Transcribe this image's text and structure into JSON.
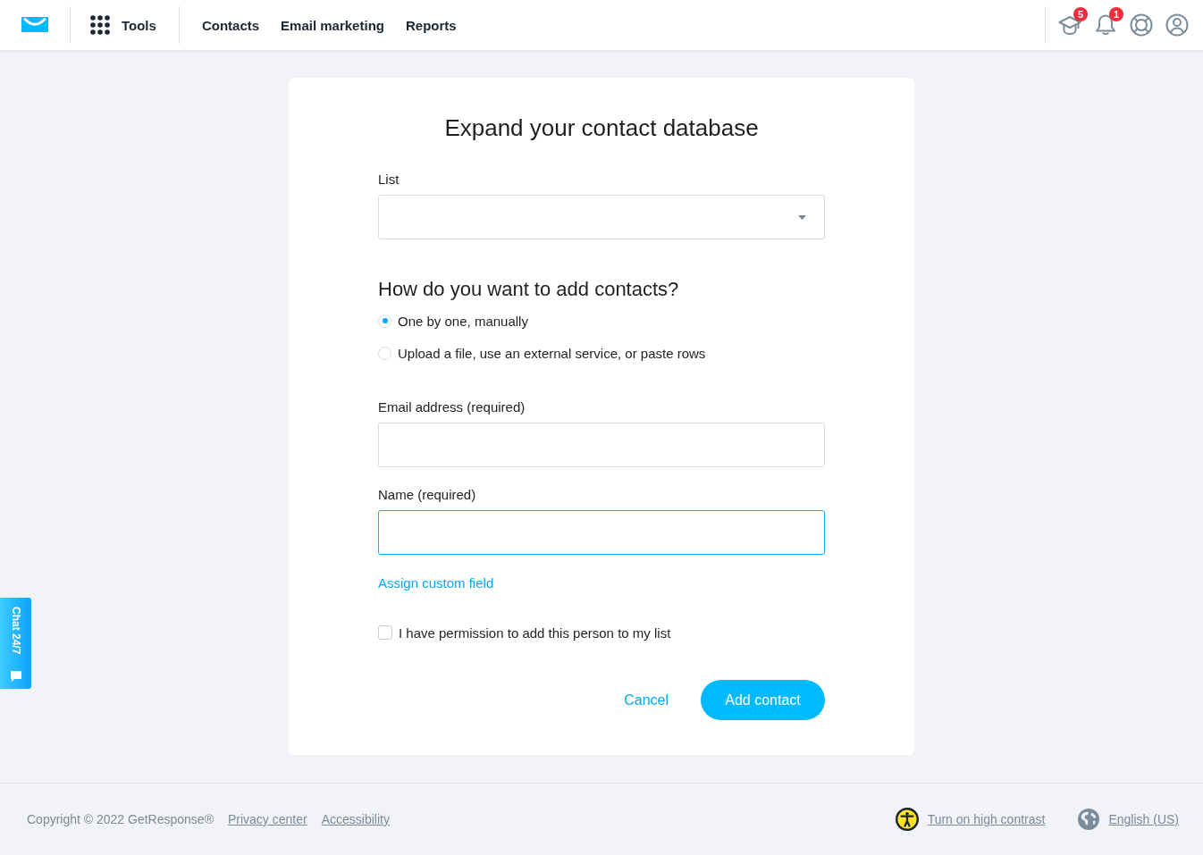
{
  "header": {
    "tools": "Tools",
    "nav": [
      "Contacts",
      "Email marketing",
      "Reports"
    ],
    "icons": [
      {
        "kind": "courses",
        "badge": "5"
      },
      {
        "kind": "notifications",
        "badge": "1"
      },
      {
        "kind": "help"
      },
      {
        "kind": "account"
      }
    ]
  },
  "form": {
    "title": "Expand your contact database",
    "list_field": {
      "label": "List"
    },
    "method": {
      "question": "How do you want to add contacts?",
      "options": [
        {
          "label": "One by one, manually",
          "selected": true
        },
        {
          "label": "Upload a file, use an external service, or paste rows",
          "selected": false
        }
      ]
    },
    "fields": [
      {
        "label": "Email address (required)",
        "focused": false
      },
      {
        "label": "Name (required)",
        "focused": true
      }
    ],
    "custom_field_link": "Assign custom field",
    "permission": {
      "label": "I have permission to add this person to my list",
      "checked": false
    },
    "cancel": "Cancel",
    "submit": "Add contact"
  },
  "chat_tab": {
    "label": "Chat 24/7"
  },
  "footer": {
    "copyright": "Copyright © 2022 GetResponse®",
    "links": [
      "Privacy center",
      "Accessibility"
    ],
    "contrast": "Turn on high contrast",
    "language": "English (US)"
  }
}
